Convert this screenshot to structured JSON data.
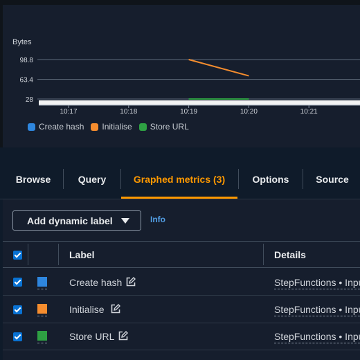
{
  "chart_data": {
    "type": "line",
    "ylabel": "Bytes",
    "yticks": [
      "98.8",
      "63.4",
      "28"
    ],
    "ylim": [
      28,
      98.8
    ],
    "x": [
      "10:17",
      "10:18",
      "10:19",
      "10:20",
      "10:21"
    ],
    "series": [
      {
        "name": "Create hash",
        "color": "#2e86de",
        "points": [
          [
            "10:19",
            28
          ],
          [
            "10:20",
            28
          ]
        ]
      },
      {
        "name": "Initialise",
        "color": "#f68d2e",
        "points": [
          [
            "10:19",
            98.8
          ],
          [
            "10:20",
            69.5
          ]
        ]
      },
      {
        "name": "Store URL",
        "color": "#2ea043",
        "points": [
          [
            "10:19",
            28
          ],
          [
            "10:20",
            28
          ]
        ]
      }
    ]
  },
  "tabs": {
    "browse": "Browse",
    "query": "Query",
    "graphed": "Graphed metrics (3)",
    "options": "Options",
    "source": "Source"
  },
  "toolbar": {
    "dynamic_label": "Add dynamic label",
    "info": "Info"
  },
  "table": {
    "headers": {
      "label": "Label",
      "details": "Details"
    },
    "rows": [
      {
        "label": "Create hash",
        "color": "#2e86de",
        "details": "StepFunctions • Inpu"
      },
      {
        "label": "Initialise",
        "color": "#f68d2e",
        "details": "StepFunctions • Inpu"
      },
      {
        "label": "Store URL",
        "color": "#2ea043",
        "details": "StepFunctions • Inpu"
      }
    ]
  }
}
